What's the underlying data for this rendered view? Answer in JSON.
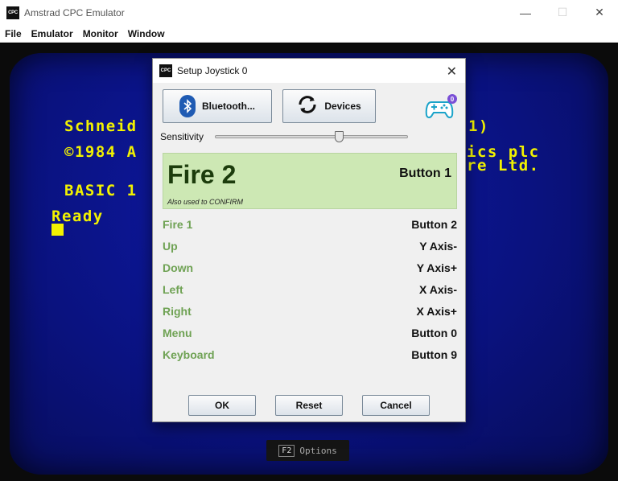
{
  "window": {
    "icon_text": "CPC",
    "title": "Amstrad CPC Emulator",
    "minimize": "—",
    "maximize": "☐",
    "close": "✕"
  },
  "menu": [
    "File",
    "Emulator",
    "Monitor",
    "Window"
  ],
  "screen": {
    "visible_lines": [
      "Schneid",
      "1)",
      "©1984 A",
      "ics plc",
      "re Ltd.",
      "BASIC 1",
      "Ready"
    ],
    "text_color": "#f2f200",
    "background_color": "#0a127f"
  },
  "options_hint": {
    "key": "F2",
    "label": "Options"
  },
  "dialog": {
    "icon_text": "CPC",
    "title": "Setup Joystick 0",
    "close": "✕",
    "bluetooth_button": "Bluetooth...",
    "devices_button": "Devices",
    "gamepad_badge": "0",
    "sensitivity_label": "Sensitivity",
    "sensitivity_value": 0.64,
    "highlight": {
      "action": "Fire 2",
      "mapping": "Button 1",
      "note": "Also used to CONFIRM"
    },
    "mappings": [
      {
        "action": "Fire 1",
        "value": "Button 2"
      },
      {
        "action": "Up",
        "value": "Y Axis-"
      },
      {
        "action": "Down",
        "value": "Y Axis+"
      },
      {
        "action": "Left",
        "value": "X Axis-"
      },
      {
        "action": "Right",
        "value": "X Axis+"
      },
      {
        "action": "Menu",
        "value": "Button 0"
      },
      {
        "action": "Keyboard",
        "value": "Button 9"
      }
    ],
    "ok_button": "OK",
    "reset_button": "Reset",
    "cancel_button": "Cancel",
    "accent_color": "#6fa254",
    "highlight_color": "#cde8b4"
  }
}
